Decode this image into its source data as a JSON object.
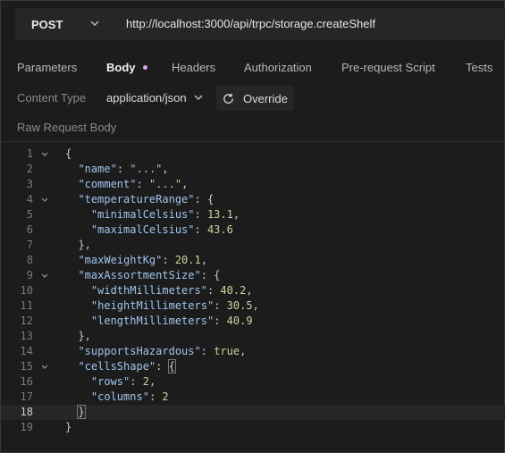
{
  "request": {
    "method": "POST",
    "url": "http://localhost:3000/api/trpc/storage.createShelf"
  },
  "tabs": [
    {
      "label": "Parameters"
    },
    {
      "label": "Body",
      "active": true
    },
    {
      "label": "Headers"
    },
    {
      "label": "Authorization"
    },
    {
      "label": "Pre-request Script"
    },
    {
      "label": "Tests"
    }
  ],
  "body": {
    "content_type_label": "Content Type",
    "content_type_value": "application/json",
    "override_label": "Override",
    "raw_label": "Raw Request Body"
  },
  "editor": {
    "current_line": 18,
    "lines": [
      {
        "n": "1",
        "fold": true
      },
      {
        "n": "2"
      },
      {
        "n": "3"
      },
      {
        "n": "4",
        "fold": true
      },
      {
        "n": "5"
      },
      {
        "n": "6"
      },
      {
        "n": "7"
      },
      {
        "n": "8"
      },
      {
        "n": "9",
        "fold": true
      },
      {
        "n": "10"
      },
      {
        "n": "11"
      },
      {
        "n": "12"
      },
      {
        "n": "13"
      },
      {
        "n": "14"
      },
      {
        "n": "15",
        "fold": true
      },
      {
        "n": "16"
      },
      {
        "n": "17"
      },
      {
        "n": "18"
      },
      {
        "n": "19"
      }
    ],
    "tokens": {
      "l1": "{",
      "l2_key": "\"name\"",
      "l2_sep": ": ",
      "l2_val": "\"...\"",
      "l2_end": ",",
      "l3_key": "\"comment\"",
      "l3_sep": ": ",
      "l3_val": "\"...\"",
      "l3_end": ",",
      "l4_key": "\"temperatureRange\"",
      "l4_sep": ": {",
      "l5_key": "\"minimalCelsius\"",
      "l5_sep": ": ",
      "l5_val": "13.1",
      "l5_end": ",",
      "l6_key": "\"maximalCelsius\"",
      "l6_sep": ": ",
      "l6_val": "43.6",
      "l7": "},",
      "l8_key": "\"maxWeightKg\"",
      "l8_sep": ": ",
      "l8_val": "20.1",
      "l8_end": ",",
      "l9_key": "\"maxAssortmentSize\"",
      "l9_sep": ": {",
      "l10_key": "\"widthMillimeters\"",
      "l10_sep": ": ",
      "l10_val": "40.2",
      "l10_end": ",",
      "l11_key": "\"heightMillimeters\"",
      "l11_sep": ": ",
      "l11_val": "30.5",
      "l11_end": ",",
      "l12_key": "\"lengthMillimeters\"",
      "l12_sep": ": ",
      "l12_val": "40.9",
      "l13": "},",
      "l14_key": "\"supportsHazardous\"",
      "l14_sep": ": ",
      "l14_val": "true",
      "l14_end": ",",
      "l15_key": "\"cellsShape\"",
      "l15_sep": ": ",
      "l15_brace": "{",
      "l16_key": "\"rows\"",
      "l16_sep": ": ",
      "l16_val": "2",
      "l16_end": ",",
      "l17_key": "\"columns\"",
      "l17_sep": ": ",
      "l17_val": "2",
      "l18": "}",
      "l19": "}"
    }
  },
  "colors": {
    "background": "#1c1c1c",
    "key": "#9fc5ec",
    "string": "#d7b98a",
    "number": "#c8d69c",
    "tab_dot": "#d9a4f5"
  }
}
